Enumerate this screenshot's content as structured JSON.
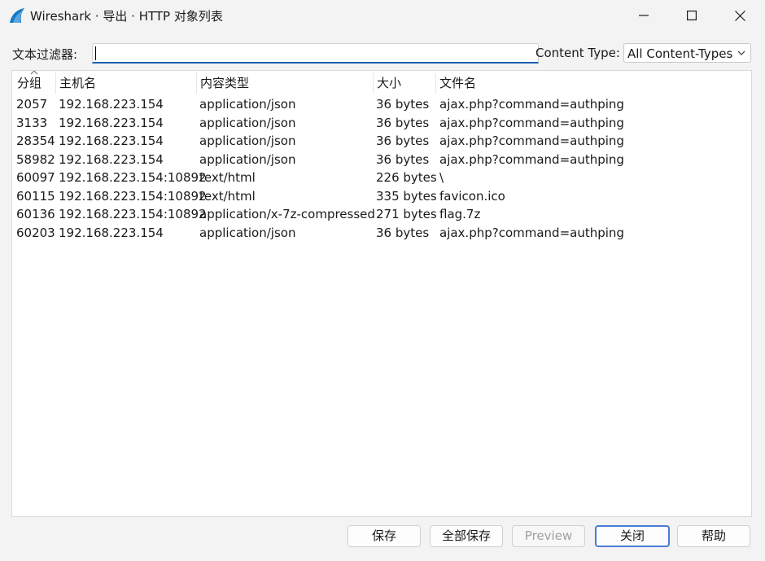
{
  "window": {
    "title": "Wireshark · 导出 · HTTP 对象列表",
    "icon": "wireshark-fin-icon"
  },
  "filter": {
    "label": "文本过滤器:",
    "value": ""
  },
  "content_type": {
    "label": "Content Type:",
    "selected": "All Content-Types"
  },
  "table": {
    "columns": [
      "分组",
      "主机名",
      "内容类型",
      "大小",
      "文件名"
    ],
    "sorted_column": "分组",
    "rows": [
      [
        "2057",
        "192.168.223.154",
        "application/json",
        "36 bytes",
        "ajax.php?command=authping"
      ],
      [
        "3133",
        "192.168.223.154",
        "application/json",
        "36 bytes",
        "ajax.php?command=authping"
      ],
      [
        "28354",
        "192.168.223.154",
        "application/json",
        "36 bytes",
        "ajax.php?command=authping"
      ],
      [
        "58982",
        "192.168.223.154",
        "application/json",
        "36 bytes",
        "ajax.php?command=authping"
      ],
      [
        "60097",
        "192.168.223.154:10892",
        "text/html",
        "226 bytes",
        "\\"
      ],
      [
        "60115",
        "192.168.223.154:10892",
        "text/html",
        "335 bytes",
        "favicon.ico"
      ],
      [
        "60136",
        "192.168.223.154:10892",
        "application/x-7z-compressed",
        "271 bytes",
        "flag.7z"
      ],
      [
        "60203",
        "192.168.223.154",
        "application/json",
        "36 bytes",
        "ajax.php?command=authping"
      ]
    ]
  },
  "buttons": {
    "save": "保存",
    "save_all": "全部保存",
    "preview": "Preview",
    "close": "关闭",
    "help": "帮助"
  },
  "colors": {
    "accent": "#1a5fb4",
    "default_button_border": "#4a7bd6",
    "disabled_text": "#a0a0a0"
  }
}
